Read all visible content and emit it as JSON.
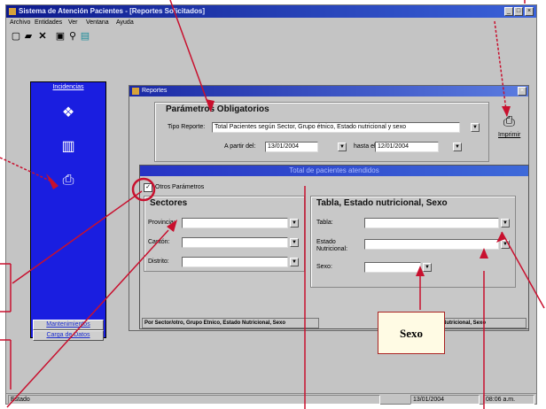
{
  "window": {
    "title": "Sistema de Atención Pacientes - [Reportes Solicitados]"
  },
  "menu": [
    "Archivo",
    "Entidades",
    "Ver",
    "Ventana",
    "Ayuda"
  ],
  "toolbar_icons": [
    "new-doc-icon",
    "open-folder-icon",
    "close-x-icon",
    "save-icon",
    "find-icon",
    "report-icon"
  ],
  "sidebar": {
    "header": "Incidencias",
    "icons": [
      "handshake-icon",
      "books-icon",
      "printer-icon"
    ],
    "buttons": [
      "Mantenimientos",
      "Carga de Datos"
    ]
  },
  "dialog": {
    "title": "Reportes",
    "params_header": "Parámetros Obligatorios",
    "tipo_label": "Tipo Reporte:",
    "tipo_value": "Total Pacientes según Sector, Grupo étnico, Estado nutricional y sexo",
    "desde_label": "A partir del:",
    "desde_value": "13/01/2004",
    "hasta_label": "hasta el:",
    "hasta_value": "12/01/2004",
    "print_label": "Imprimir"
  },
  "panel": {
    "title": "Total de pacientes atendidos",
    "otros_checkbox": "Otros Parámetros",
    "sectores_header": "Sectores",
    "provincia_label": "Provincia:",
    "canton_label": "Cantón:",
    "distrito_label": "Distrito:",
    "tabla_header": "Tabla, Estado nutricional, Sexo",
    "tabla_label": "Tabla:",
    "estado_label": "Estado Nutricional:",
    "sexo_label": "Sexo:",
    "footer_left": "Por Sector/otro, Grupo Etnico, Estado Nutricional, Sexo",
    "footer_right": "Nutricional, Sexo"
  },
  "callout": {
    "label": "Sexo"
  },
  "status": {
    "left": "Estado",
    "date": "13/01/2004",
    "time": "08:06 a.m."
  }
}
